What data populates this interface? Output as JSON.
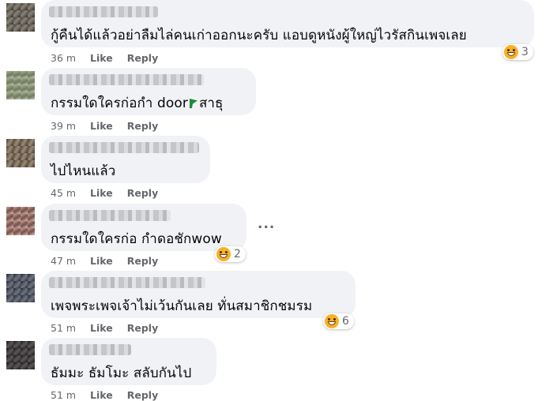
{
  "comments": [
    {
      "text": "กู้คืนได้แล้วอย่าลืมไล่คนเก่าออกนะครับ แอบดูหนังผู้ใหญ่ไวรัสกินเพจเลย",
      "time": "36 m",
      "like": "Like",
      "reply": "Reply",
      "reaction": {
        "icon": "grin-emoji-icon",
        "count": "3"
      }
    },
    {
      "text_before": "กรรมใดใครก่อกำ door",
      "text_after": "สาธุ",
      "time": "39 m",
      "like": "Like",
      "reply": "Reply"
    },
    {
      "text": "ไปไหนแล้ว",
      "time": "45 m",
      "like": "Like",
      "reply": "Reply"
    },
    {
      "text": "กรรมใดใครก่อ กำดอชักwow",
      "time": "47 m",
      "like": "Like",
      "reply": "Reply",
      "reaction": {
        "icon": "grin-emoji-icon",
        "count": "2"
      },
      "more": "..."
    },
    {
      "text": "เพจพระเพจเจ้าไม่เว้นกันเลย ทั่นสมาชิกชมรม",
      "time": "51 m",
      "like": "Like",
      "reply": "Reply",
      "reaction": {
        "icon": "grin-emoji-icon",
        "count": "6"
      }
    },
    {
      "text": "ธัมมะ ธัมโมะ สลับกันไป",
      "time": "51 m",
      "like": "Like",
      "reply": "Reply"
    }
  ],
  "colors": {
    "bubble": "#f0f2f5",
    "meta": "#65676b",
    "emoji": "#f7b125"
  }
}
